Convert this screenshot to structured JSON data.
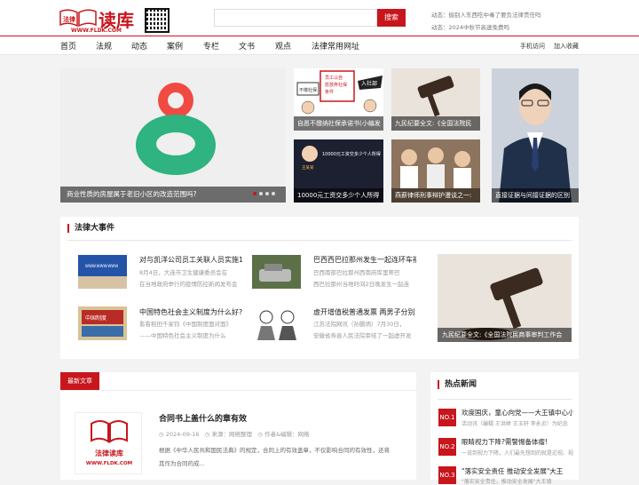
{
  "header": {
    "logo_text": "读库",
    "logo_badge": "法律",
    "logo_url": "WWW.FLDK.COM",
    "search_placeholder": "",
    "search_button": "搜索",
    "ticker": [
      "动态：偷别人东西吃中毒了要负法律责任吗",
      "动态：2024中秋节高速免费吗"
    ]
  },
  "nav": {
    "items": [
      "首页",
      "法规",
      "动态",
      "案例",
      "专栏",
      "文书",
      "观点",
      "法律常用网址"
    ],
    "right": [
      "手机访问",
      "加入收藏"
    ]
  },
  "carousel": {
    "caption": "商业性质的房屋属于老旧小区的改造范围吗?",
    "slides": 4,
    "active": 1
  },
  "thumbs": [
    {
      "caption": "自愿不缴纳社保承诺书(小编发"
    },
    {
      "caption": "九民纪要全文:《全国法院民"
    },
    {
      "caption": "10000元工资交多少个人所得"
    },
    {
      "caption": "燕薪律师刑事辩护漫谈之一:"
    }
  ],
  "thumb_art": {
    "poster_lines": [
      "员工以自",
      "愿放弃社保",
      "条件"
    ],
    "poster_label": "不缴社保",
    "poster_tag": "入社部",
    "tax_headline": "10000元工资交多少个人所得",
    "tax_name": "王某某"
  },
  "portrait": {
    "caption": "直接证据与间接证据的区别"
  },
  "events": {
    "title": "法律大事件",
    "items": [
      {
        "title": "对与凯洋公司员工关联人员实施1",
        "desc": [
          "8月4日，大连市卫生健康委员会在",
          "在当地政府举行的疫情防控新闻发布会"
        ]
      },
      {
        "title": "巴西西巴拉那州发生一起连环车祸 5",
        "desc": [
          "巴西南部巴拉那州西南府库里蒂巴",
          "西巴拉那州当地时间2日晚发生一起连"
        ]
      },
      {
        "title": "中国特色社会主义制度为什么好?",
        "desc": [
          "看看稻田千家钧《中国制度面对面》",
          "——中国特色社会主义制度为什么"
        ]
      },
      {
        "title": "虚开增值税普通发票 两男子分别",
        "desc": [
          "江苏法院网讯（孙鹏炳）7月30日，",
          "安徽省寿县人民法院审结了一起虚开发"
        ]
      }
    ],
    "feature_caption": "九民纪要全文:《全国法院民商事审判工作会",
    "img_text": {
      "ev1": "WWW.WWW.WWW",
      "ev3": "中国制度"
    }
  },
  "latest": {
    "tab": "最新文章",
    "article": {
      "title": "合同书上盖什么的章有效",
      "date": "2024-09-16",
      "source": "来源：网络整理",
      "author": "作者&编辑：网络",
      "summary": [
        "根据《中华人民共和国民法典》的规定，合同上的有效盖章，不仅影响合同的有效性，还将",
        "其作为合同的成..."
      ],
      "thumb_text": "法律读库",
      "thumb_url": "WWW.FLDK.COM"
    }
  },
  "hot": {
    "title": "热点新闻",
    "items": [
      {
        "num": "NO.1",
        "title": "欢度国庆，童心向党——大王镇中心小",
        "desc": "活动讯（编辑 王洪婷 王玉轩 李永贞）为纪念"
      },
      {
        "num": "NO.2",
        "title": "眼睛视力下降?需警惕备体瘤!",
        "desc": "一说到视力下降，人们最先想到的就是近视、视"
      },
      {
        "num": "NO.3",
        "title": "\"落实安全责任 推动安全发展\"大王",
        "desc": "\"落实安全责任，推动安全发展\"大王镇"
      }
    ]
  },
  "colors": {
    "accent": "#c8161d"
  }
}
